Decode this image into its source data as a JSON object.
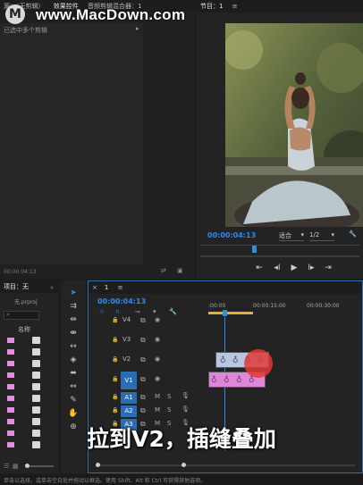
{
  "watermark": {
    "logo": "M",
    "text": "www.MacDown.com"
  },
  "source_panel": {
    "tabs": [
      "源：（无剪辑）",
      "效果控件",
      "音频剪辑混合器：1"
    ],
    "menu_icon": "≡",
    "empty_text": "已选中多个剪辑",
    "timecode": "00:00:04:13"
  },
  "program_monitor": {
    "title": "节目：1",
    "menu_icon": "≡",
    "timecode": "00:00:04:13",
    "fit": "适合",
    "resolution": "1/2",
    "buttons": [
      "go-in-icon",
      "step-back-icon",
      "play-icon",
      "step-forward-icon",
      "go-out-icon"
    ]
  },
  "project_panel": {
    "title": "项目：无",
    "tab2": "媒",
    "file": "无.prproj",
    "column_name": "名称",
    "search_icon": "search-icon",
    "row_count": 10
  },
  "tools": [
    "selection-tool",
    "track-select-tool",
    "ripple-edit-tool",
    "rolling-edit-tool",
    "rate-stretch-tool",
    "razor-tool",
    "slip-tool",
    "slide-tool",
    "pen-tool",
    "hand-tool",
    "zoom-tool"
  ],
  "timeline": {
    "sequence": "1",
    "timecode": "00:00:04:13",
    "ruler_labels": [
      ":00:00",
      "00:00:15:00",
      "00:00:30:00"
    ],
    "video_tracks": [
      "V4",
      "V3",
      "V2",
      "V1"
    ],
    "audio_tracks": [
      "A1",
      "A2",
      "A3"
    ],
    "track_button_m": "M",
    "track_button_s": "S"
  },
  "status_bar": "单击以选择，或单击空白处并拖动以框选。使用 Shift、Alt 和 Ctrl 可获得其他选项。",
  "caption": "拉到V2，插缝叠加",
  "colors": {
    "accent_blue": "#2d8ceb",
    "clip_pink": "#df86d8",
    "clip_blue": "#b7c7dd",
    "playhead_blue": "#2d8ceb",
    "highlight_red": "#e03a36"
  }
}
